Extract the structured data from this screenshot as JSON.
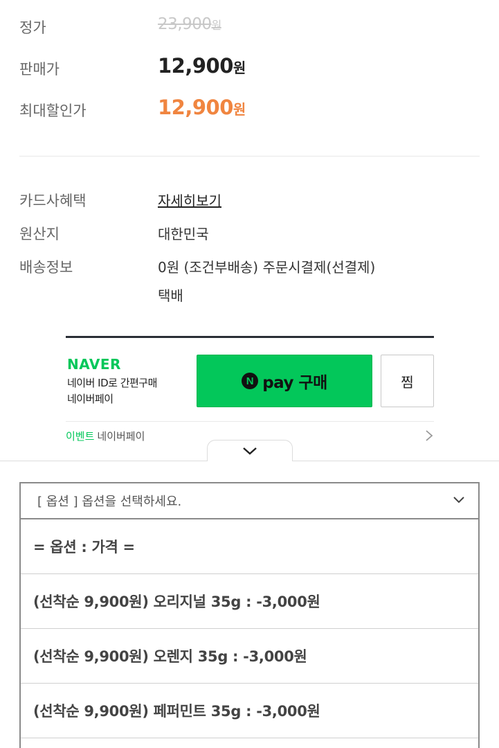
{
  "prices": {
    "list_label": "정가",
    "list_value": "23,900",
    "list_unit": "원",
    "sale_label": "판매가",
    "sale_value": "12,900",
    "sale_unit": "원",
    "max_label": "최대할인가",
    "max_value": "12,900",
    "max_unit": "원"
  },
  "info": {
    "card_label": "카드사혜택",
    "card_link": "자세히보기",
    "origin_label": "원산지",
    "origin_value": "대한민국",
    "shipping_label": "배송정보",
    "shipping_line1": "0원 (조건부배송) 주문시결제(선결제)",
    "shipping_line2": "택배"
  },
  "naver": {
    "logo": "NAVER",
    "desc_line1": "네이버 ID로 간편구매",
    "desc_line2": "네이버페이",
    "npay_n": "N",
    "npay_label": "pay 구매",
    "zzim_label": "찜",
    "event_tag": "이벤트",
    "event_text": "네이버페이",
    "colors": {
      "brand": "#03c75a"
    }
  },
  "options": {
    "select_placeholder": "[ 옵션 ] 옵션을 선택하세요.",
    "items": [
      "= 옵션 : 가격 =",
      "(선착순 9,900원) 오리지널 35g : -3,000원",
      "(선착순 9,900원) 오렌지 35g : -3,000원",
      "(선착순 9,900원) 페퍼민트 35g : -3,000원"
    ]
  },
  "colors": {
    "accent_orange": "#f08540",
    "strike_gray": "#c8c8c8"
  }
}
